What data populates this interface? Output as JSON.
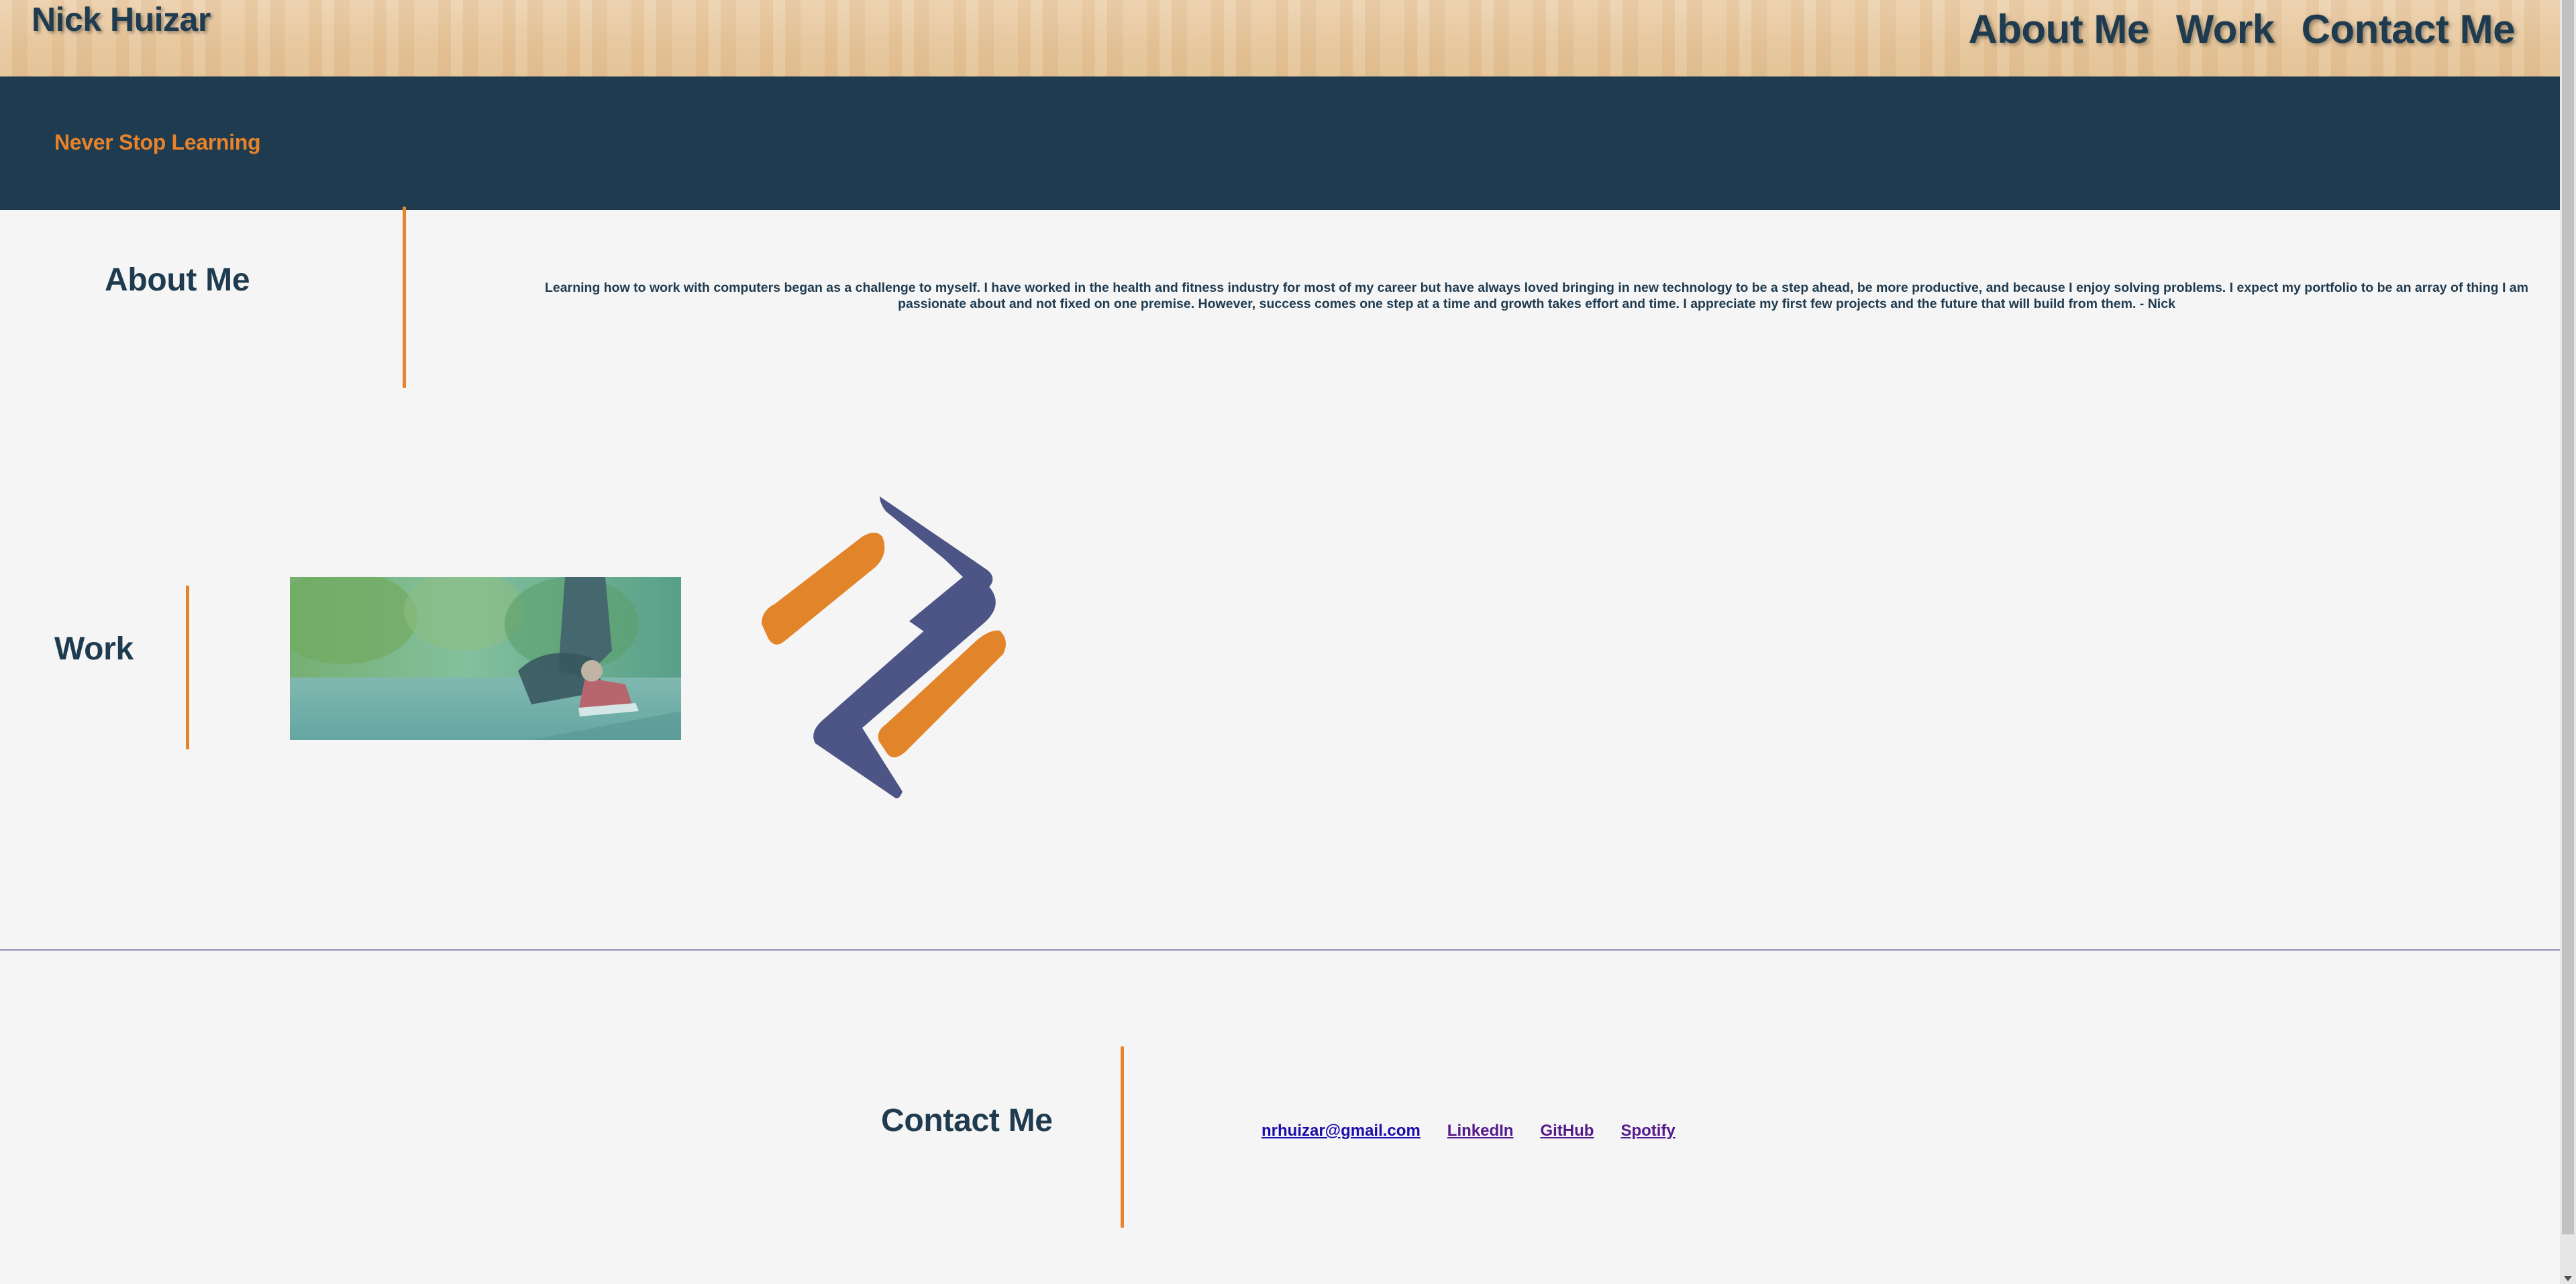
{
  "header": {
    "brand": "Nick Huizar",
    "nav": [
      {
        "label": "About Me"
      },
      {
        "label": "Work"
      },
      {
        "label": "Contact Me"
      }
    ]
  },
  "hero": {
    "tagline": "Never Stop Learning"
  },
  "about": {
    "heading": "About Me",
    "text": "Learning how to work with computers began as a challenge to myself. I have worked in the health and fitness industry for most of my career but have always loved bringing in new technology to be a step ahead, be more productive, and because I enjoy solving problems. I expect my portfolio to be an array of thing I am passionate about and not fixed on one premise. However, success comes one step at a time and growth takes effort and time. I appreciate my first few projects and the future that will build from them. - Nick"
  },
  "work": {
    "heading": "Work",
    "project_image": "runner-tying-shoe-photo",
    "logo": "orange-navy-interlocking-logo"
  },
  "contact": {
    "heading": "Contact Me",
    "links": [
      {
        "label": "nrhuizar@gmail.com"
      },
      {
        "label": "LinkedIn"
      },
      {
        "label": "GitHub"
      },
      {
        "label": "Spotify"
      }
    ]
  },
  "colors": {
    "navy": "#1f3b4f",
    "orange": "#e7832a",
    "logo_blue": "#4c5586",
    "background": "#f5f5f6"
  }
}
